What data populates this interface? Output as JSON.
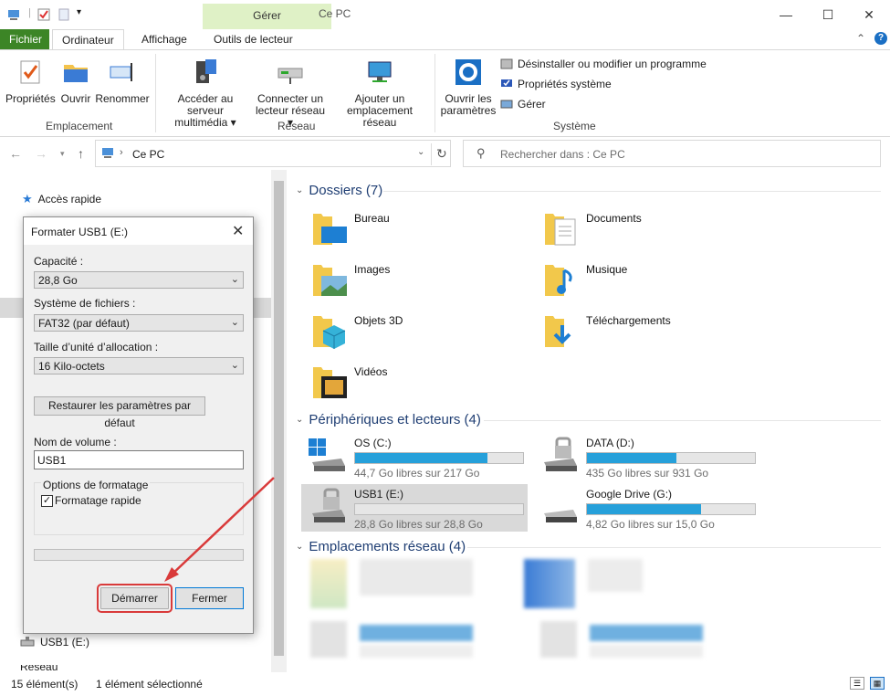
{
  "titlebar": {
    "context_group": "Gérer",
    "title": "Ce PC"
  },
  "tabs": {
    "fichier": "Fichier",
    "ordinateur": "Ordinateur",
    "affichage": "Affichage",
    "outils": "Outils de lecteur"
  },
  "ribbon": {
    "proprietes": "Propriétés",
    "ouvrir": "Ouvrir",
    "renommer": "Renommer",
    "group_emplacement": "Emplacement",
    "acceder_l1": "Accéder au serveur",
    "acceder_l2": "multimédia ▾",
    "connecter_l1": "Connecter un",
    "connecter_l2": "lecteur réseau ▾",
    "ajouter_l1": "Ajouter un",
    "ajouter_l2": "emplacement réseau",
    "group_reseau": "Réseau",
    "ouvrir_params_l1": "Ouvrir les",
    "ouvrir_params_l2": "paramètres",
    "desinstaller": "Désinstaller ou modifier un programme",
    "props_systeme": "Propriétés système",
    "gerer": "Gérer",
    "group_systeme": "Système"
  },
  "address": {
    "path": "Ce PC",
    "search_placeholder": "Rechercher dans : Ce PC"
  },
  "navpane": {
    "acces_rapide": "Accès rapide",
    "usb1": "USB1 (E:)",
    "reseau": "Réseau"
  },
  "content": {
    "dossiers_header": "Dossiers (7)",
    "folders": [
      "Bureau",
      "Documents",
      "Images",
      "Musique",
      "Objets 3D",
      "Téléchargements",
      "Vidéos"
    ],
    "peripheriques_header": "Périphériques et lecteurs (4)",
    "drives": [
      {
        "name": "OS (C:)",
        "free": "44,7 Go libres sur 217 Go",
        "used_fraction": 0.79
      },
      {
        "name": "DATA (D:)",
        "free": "435 Go libres sur 931 Go",
        "used_fraction": 0.53
      },
      {
        "name": "USB1 (E:)",
        "free": "28,8 Go libres sur 28,8 Go",
        "used_fraction": 0.0
      },
      {
        "name": "Google Drive (G:)",
        "free": "4,82 Go libres sur 15,0 Go",
        "used_fraction": 0.68
      }
    ],
    "reseau_header": "Emplacements réseau (4)"
  },
  "statusbar": {
    "count": "15 élément(s)",
    "selected": "1 élément sélectionné"
  },
  "dialog": {
    "title": "Formater USB1 (E:)",
    "capacite_label": "Capacité :",
    "capacite_value": "28,8 Go",
    "systeme_label": "Système de fichiers :",
    "systeme_value": "FAT32 (par défaut)",
    "taille_label": "Taille d’unité d’allocation :",
    "taille_value": "16 Kilo-octets",
    "restaurer": "Restaurer les paramètres par défaut",
    "nom_label": "Nom de volume :",
    "nom_value": "USB1",
    "options_label": "Options de formatage",
    "rapide_label": "Formatage rapide",
    "demarrer": "Démarrer",
    "fermer": "Fermer"
  },
  "colors": {
    "accent": "#26a0da",
    "highlight_red": "#d93a3a",
    "context_green": "#dff1c6"
  }
}
